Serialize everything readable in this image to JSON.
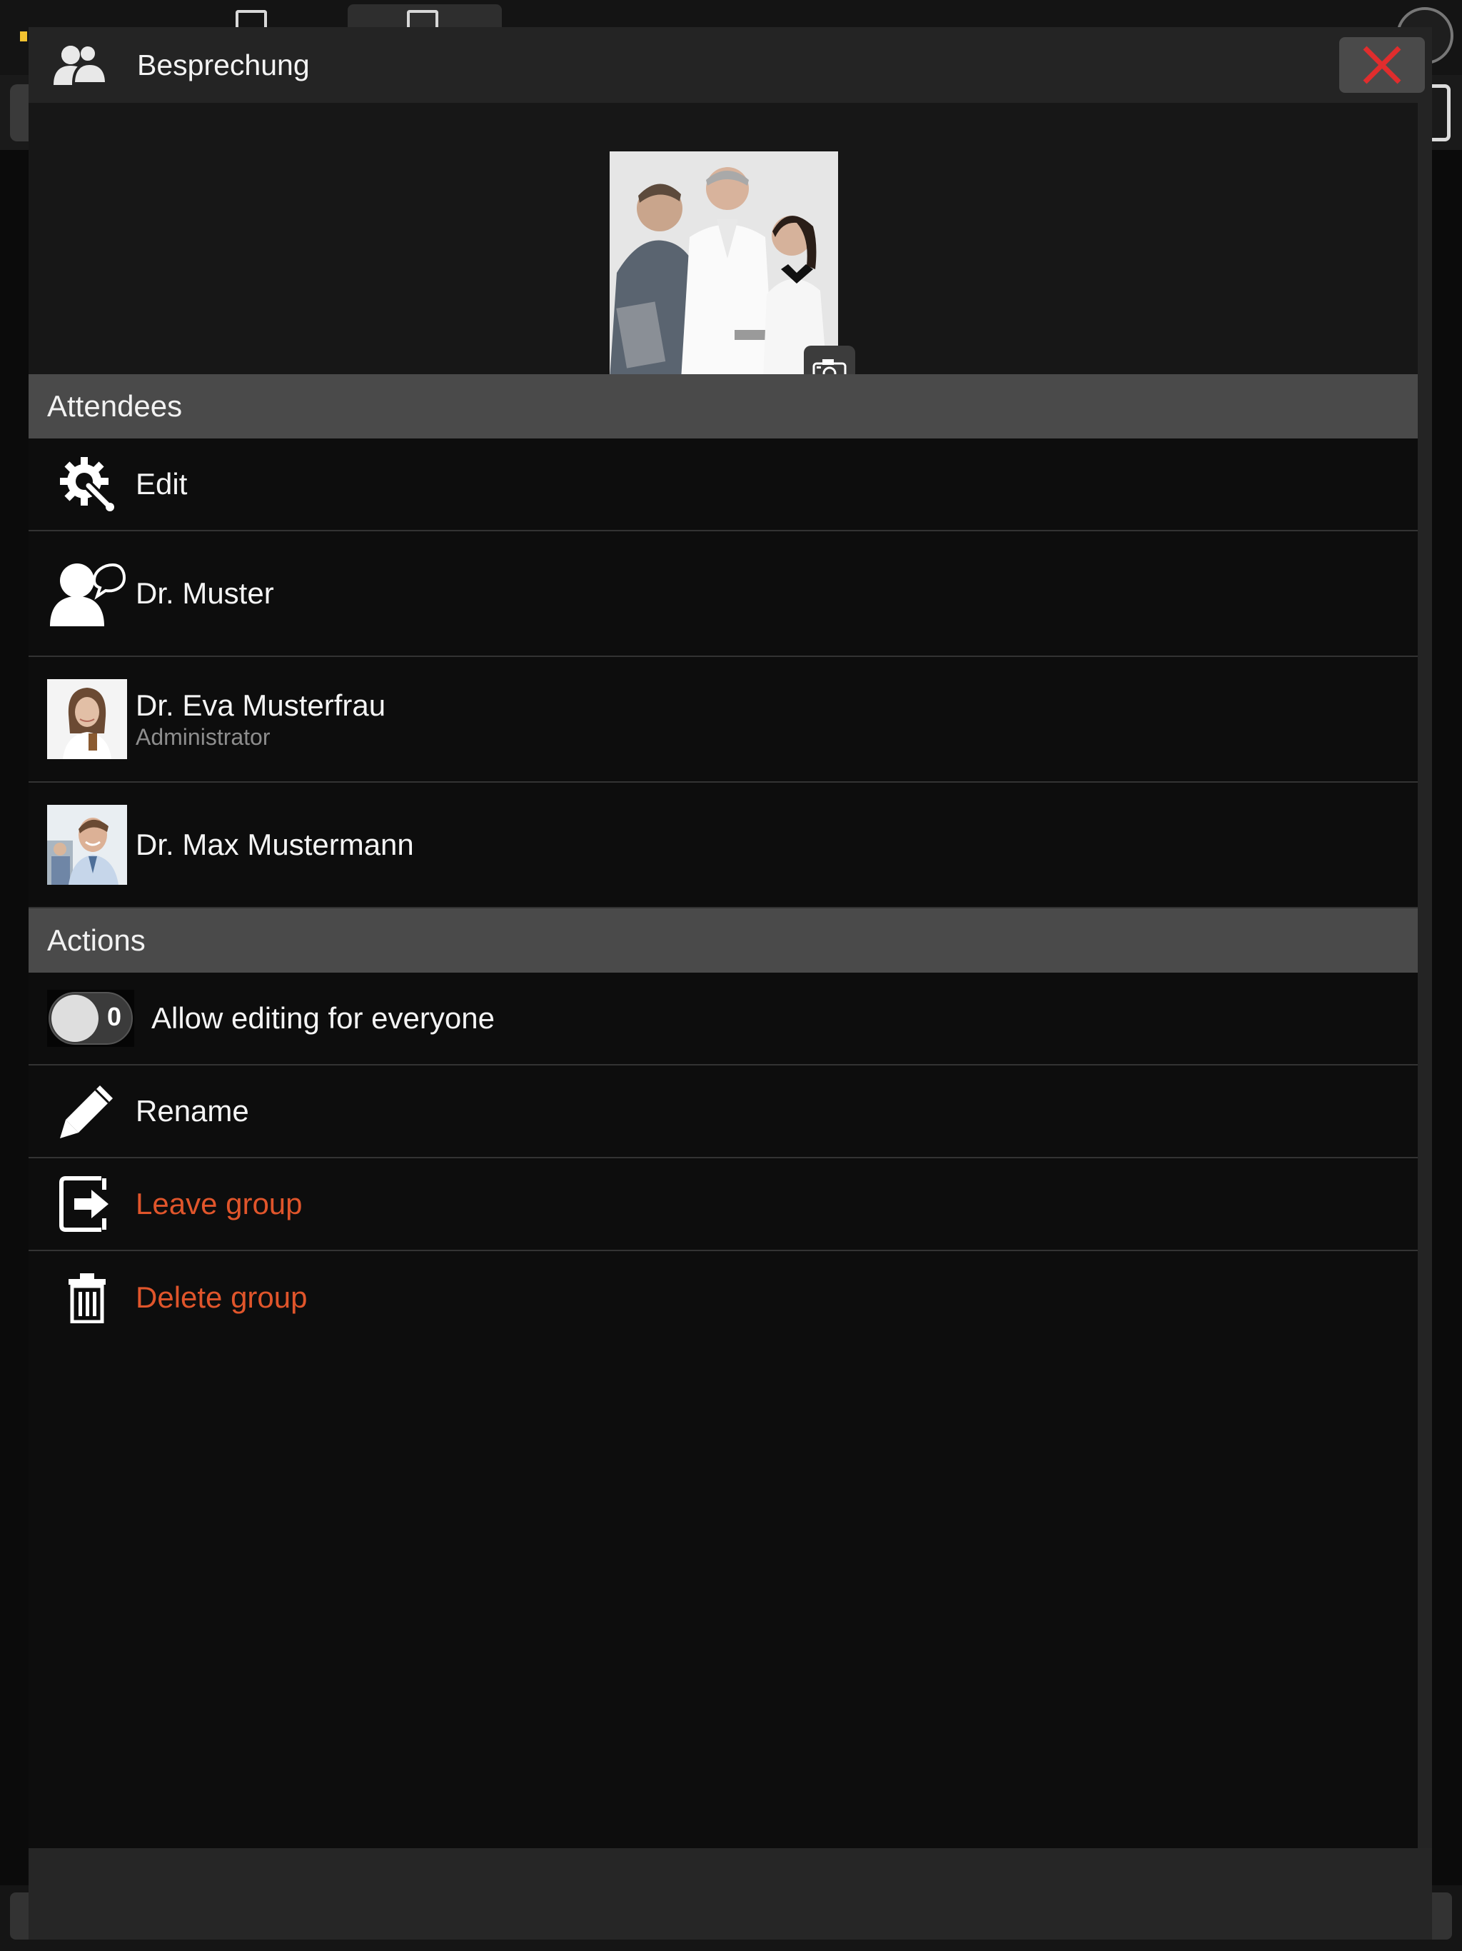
{
  "dialog": {
    "title": "Besprechung",
    "header_icon": "group-users-icon",
    "close_icon": "close-x-icon",
    "photo_camera_icon": "camera-icon"
  },
  "attendees": {
    "header": "Attendees",
    "edit_label": "Edit",
    "edit_icon": "gear-wrench-icon",
    "items": [
      {
        "name": "Dr. Muster",
        "role": "",
        "avatar": "contact-placeholder-icon"
      },
      {
        "name": "Dr. Eva Musterfrau",
        "role": "Administrator",
        "avatar": "photo"
      },
      {
        "name": "Dr. Max Mustermann",
        "role": "",
        "avatar": "photo"
      }
    ]
  },
  "actions": {
    "header": "Actions",
    "allow_editing": {
      "label": "Allow editing for everyone",
      "state": "0",
      "on": false
    },
    "rename_label": "Rename",
    "leave_label": "Leave group",
    "delete_label": "Delete group"
  },
  "colors": {
    "danger": "#e0552b",
    "close": "#e02d2d",
    "section_bg": "#4a4a4a",
    "dialog_bg": "#0d0d0d"
  }
}
